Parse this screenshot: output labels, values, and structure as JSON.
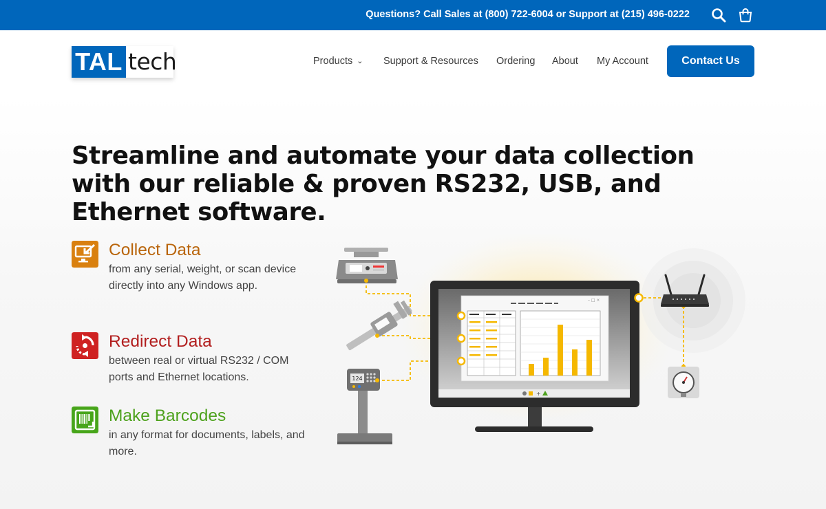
{
  "topbar": {
    "questions": "Questions?",
    "call_sales": "Call Sales at",
    "sales_phone": "(800) 722-6004",
    "or_support": "or Support at",
    "support_phone": "(215) 496-0222"
  },
  "logo": {
    "part1": "TAL",
    "part2": "tech"
  },
  "nav": {
    "products": "Products",
    "support": "Support & Resources",
    "ordering": "Ordering",
    "about": "About",
    "account": "My Account"
  },
  "contact_button": "Contact Us",
  "headline": "Streamline and automate your data collection with our reliable & proven RS232, USB, and Ethernet software.",
  "features": [
    {
      "title": "Collect Data",
      "desc": "from any serial, weight, or scan device directly into any Windows app.",
      "color": "#b9650b",
      "icon": "collect-data-icon"
    },
    {
      "title": "Redirect Data",
      "desc": "between real or virtual RS232 / COM ports and Ethernet locations.",
      "color": "#b21e1e",
      "icon": "redirect-data-icon"
    },
    {
      "title": "Make Barcodes",
      "desc": "in any format for documents, labels, and more.",
      "color": "#4ea21e",
      "icon": "barcode-icon"
    }
  ],
  "illustration": {
    "scale_display": "124"
  },
  "colors": {
    "brand_blue": "#0066bb",
    "accent_yellow": "#f5b800"
  }
}
